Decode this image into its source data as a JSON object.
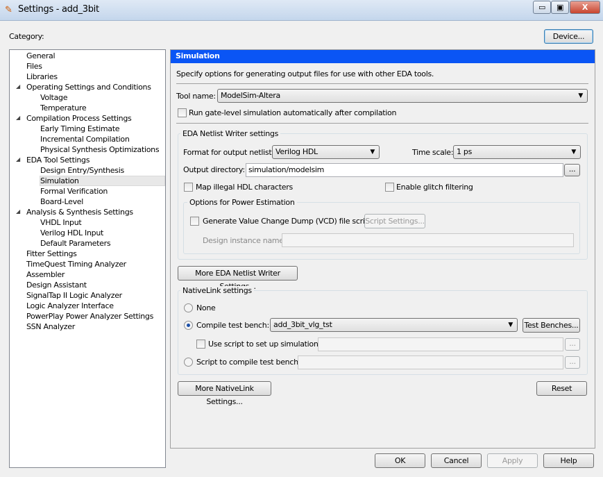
{
  "window": {
    "title": "Settings - add_3bit",
    "minimize": "▭",
    "maximize": "▣",
    "close": "X"
  },
  "category_label": "Category:",
  "device_button": "Device...",
  "tree": [
    {
      "label": "General",
      "level": 0
    },
    {
      "label": "Files",
      "level": 0
    },
    {
      "label": "Libraries",
      "level": 0
    },
    {
      "label": "Operating Settings and Conditions",
      "level": 0,
      "expanded": true
    },
    {
      "label": "Voltage",
      "level": 1
    },
    {
      "label": "Temperature",
      "level": 1
    },
    {
      "label": "Compilation Process Settings",
      "level": 0,
      "expanded": true
    },
    {
      "label": "Early Timing Estimate",
      "level": 1
    },
    {
      "label": "Incremental Compilation",
      "level": 1
    },
    {
      "label": "Physical Synthesis Optimizations",
      "level": 1
    },
    {
      "label": "EDA Tool Settings",
      "level": 0,
      "expanded": true
    },
    {
      "label": "Design Entry/Synthesis",
      "level": 1
    },
    {
      "label": "Simulation",
      "level": 1,
      "selected": true
    },
    {
      "label": "Formal Verification",
      "level": 1
    },
    {
      "label": "Board-Level",
      "level": 1
    },
    {
      "label": "Analysis & Synthesis Settings",
      "level": 0,
      "expanded": true
    },
    {
      "label": "VHDL Input",
      "level": 1
    },
    {
      "label": "Verilog HDL Input",
      "level": 1
    },
    {
      "label": "Default Parameters",
      "level": 1
    },
    {
      "label": "Fitter Settings",
      "level": 0
    },
    {
      "label": "TimeQuest Timing Analyzer",
      "level": 0
    },
    {
      "label": "Assembler",
      "level": 0
    },
    {
      "label": "Design Assistant",
      "level": 0
    },
    {
      "label": "SignalTap II Logic Analyzer",
      "level": 0
    },
    {
      "label": "Logic Analyzer Interface",
      "level": 0
    },
    {
      "label": "PowerPlay Power Analyzer Settings",
      "level": 0
    },
    {
      "label": "SSN Analyzer",
      "level": 0
    }
  ],
  "main": {
    "header": "Simulation",
    "description": "Specify options for generating output files for use with other EDA tools.",
    "tool_name_label": "Tool name:",
    "tool_name_value": "ModelSim-Altera",
    "run_gate_level": {
      "label": "Run gate-level simulation automatically after compilation",
      "checked": false
    },
    "netlist": {
      "title": "EDA Netlist Writer settings",
      "format_label": "Format for output netlist:",
      "format_value": "Verilog HDL",
      "timescale_label": "Time scale:",
      "timescale_value": "1 ps",
      "outdir_label": "Output directory:",
      "outdir_value": "simulation/modelsim",
      "browse": "...",
      "map_illegal": {
        "label": "Map illegal HDL characters",
        "checked": false
      },
      "glitch": {
        "label": "Enable glitch filtering",
        "checked": false
      },
      "power": {
        "title": "Options for Power Estimation",
        "vcd": {
          "label": "Generate Value Change Dump (VCD) file script",
          "checked": false
        },
        "script_settings": "Script Settings...",
        "instance_label": "Design instance name:",
        "instance_value": ""
      }
    },
    "more_netlist": "More EDA Netlist Writer Settings...",
    "nativelink": {
      "title": "NativeLink settings",
      "none": "None",
      "compile_tb": "Compile test bench:",
      "compile_tb_value": "add_3bit_vlg_tst",
      "test_benches": "Test Benches...",
      "use_script": {
        "label": "Use script to set up simulation:",
        "checked": false
      },
      "use_script_value": "",
      "script_compile": "Script to compile test bench:",
      "script_compile_value": "",
      "browse": "...",
      "selected": "compile_tb"
    },
    "more_nativelink": "More NativeLink Settings...",
    "reset": "Reset"
  },
  "footer": {
    "ok": "OK",
    "cancel": "Cancel",
    "apply": "Apply",
    "help": "Help"
  },
  "colors": {
    "header_bg": "#0a55f5",
    "selected_bg": "#e8e8e8"
  }
}
